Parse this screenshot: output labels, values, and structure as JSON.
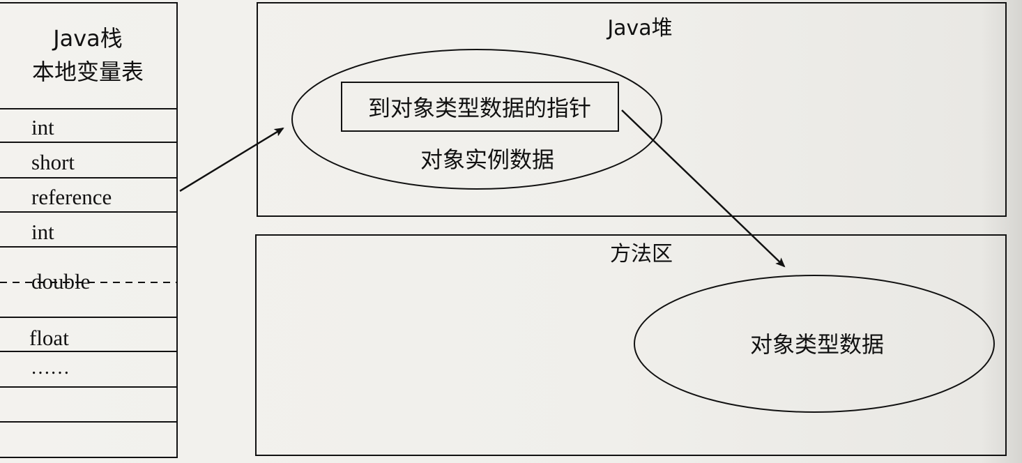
{
  "stack": {
    "title_line1": "Java栈",
    "title_line2": "本地变量表",
    "slots": [
      "int",
      "short",
      "reference",
      "int",
      "double",
      "float",
      "……"
    ]
  },
  "heap": {
    "title": "Java堆",
    "pointer_label": "到对象类型数据的指针",
    "instance_label": "对象实例数据"
  },
  "method_area": {
    "title": "方法区",
    "type_data_label": "对象类型数据"
  }
}
